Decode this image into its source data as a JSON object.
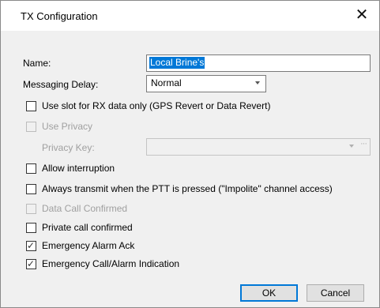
{
  "window": {
    "title": "TX Configuration",
    "close_glyph": "✕"
  },
  "form": {
    "name_label": "Name:",
    "name_value": "Local Brine's",
    "messaging_delay_label": "Messaging Delay:",
    "messaging_delay_value": "Normal",
    "privacy_key_label": "Privacy Key:",
    "privacy_key_value": "",
    "privacy_key_more": "···"
  },
  "checkboxes": [
    {
      "label": "Use slot for RX data only (GPS Revert or Data Revert)",
      "checked": false,
      "enabled": true
    },
    {
      "label": "Use Privacy",
      "checked": false,
      "enabled": false
    },
    {
      "label": "Allow interruption",
      "checked": false,
      "enabled": true
    },
    {
      "label": "Always transmit when the PTT is pressed (\"Impolite\" channel access)",
      "checked": false,
      "enabled": true
    },
    {
      "label": "Data Call Confirmed",
      "checked": false,
      "enabled": false
    },
    {
      "label": "Private call confirmed",
      "checked": false,
      "enabled": true
    },
    {
      "label": "Emergency Alarm Ack",
      "checked": true,
      "enabled": true
    },
    {
      "label": "Emergency Call/Alarm Indication",
      "checked": true,
      "enabled": true
    }
  ],
  "buttons": {
    "ok": "OK",
    "cancel": "Cancel"
  },
  "colors": {
    "selection": "#0078d7",
    "dialog_bg": "#f0f0f0",
    "disabled_text": "#a0a0a0"
  }
}
